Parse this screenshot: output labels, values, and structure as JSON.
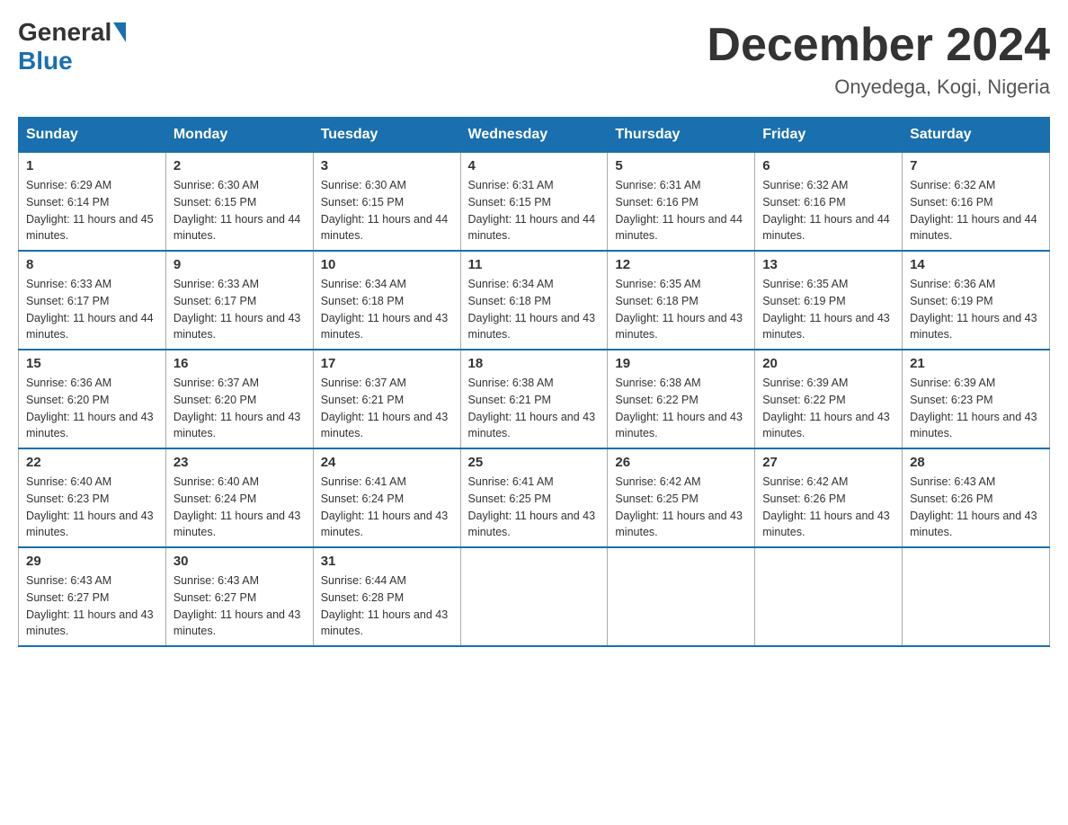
{
  "header": {
    "logo_general": "General",
    "logo_blue": "Blue",
    "month_title": "December 2024",
    "location": "Onyedega, Kogi, Nigeria"
  },
  "weekdays": [
    "Sunday",
    "Monday",
    "Tuesday",
    "Wednesday",
    "Thursday",
    "Friday",
    "Saturday"
  ],
  "weeks": [
    [
      {
        "day": "1",
        "sunrise": "6:29 AM",
        "sunset": "6:14 PM",
        "daylight": "11 hours and 45 minutes."
      },
      {
        "day": "2",
        "sunrise": "6:30 AM",
        "sunset": "6:15 PM",
        "daylight": "11 hours and 44 minutes."
      },
      {
        "day": "3",
        "sunrise": "6:30 AM",
        "sunset": "6:15 PM",
        "daylight": "11 hours and 44 minutes."
      },
      {
        "day": "4",
        "sunrise": "6:31 AM",
        "sunset": "6:15 PM",
        "daylight": "11 hours and 44 minutes."
      },
      {
        "day": "5",
        "sunrise": "6:31 AM",
        "sunset": "6:16 PM",
        "daylight": "11 hours and 44 minutes."
      },
      {
        "day": "6",
        "sunrise": "6:32 AM",
        "sunset": "6:16 PM",
        "daylight": "11 hours and 44 minutes."
      },
      {
        "day": "7",
        "sunrise": "6:32 AM",
        "sunset": "6:16 PM",
        "daylight": "11 hours and 44 minutes."
      }
    ],
    [
      {
        "day": "8",
        "sunrise": "6:33 AM",
        "sunset": "6:17 PM",
        "daylight": "11 hours and 44 minutes."
      },
      {
        "day": "9",
        "sunrise": "6:33 AM",
        "sunset": "6:17 PM",
        "daylight": "11 hours and 43 minutes."
      },
      {
        "day": "10",
        "sunrise": "6:34 AM",
        "sunset": "6:18 PM",
        "daylight": "11 hours and 43 minutes."
      },
      {
        "day": "11",
        "sunrise": "6:34 AM",
        "sunset": "6:18 PM",
        "daylight": "11 hours and 43 minutes."
      },
      {
        "day": "12",
        "sunrise": "6:35 AM",
        "sunset": "6:18 PM",
        "daylight": "11 hours and 43 minutes."
      },
      {
        "day": "13",
        "sunrise": "6:35 AM",
        "sunset": "6:19 PM",
        "daylight": "11 hours and 43 minutes."
      },
      {
        "day": "14",
        "sunrise": "6:36 AM",
        "sunset": "6:19 PM",
        "daylight": "11 hours and 43 minutes."
      }
    ],
    [
      {
        "day": "15",
        "sunrise": "6:36 AM",
        "sunset": "6:20 PM",
        "daylight": "11 hours and 43 minutes."
      },
      {
        "day": "16",
        "sunrise": "6:37 AM",
        "sunset": "6:20 PM",
        "daylight": "11 hours and 43 minutes."
      },
      {
        "day": "17",
        "sunrise": "6:37 AM",
        "sunset": "6:21 PM",
        "daylight": "11 hours and 43 minutes."
      },
      {
        "day": "18",
        "sunrise": "6:38 AM",
        "sunset": "6:21 PM",
        "daylight": "11 hours and 43 minutes."
      },
      {
        "day": "19",
        "sunrise": "6:38 AM",
        "sunset": "6:22 PM",
        "daylight": "11 hours and 43 minutes."
      },
      {
        "day": "20",
        "sunrise": "6:39 AM",
        "sunset": "6:22 PM",
        "daylight": "11 hours and 43 minutes."
      },
      {
        "day": "21",
        "sunrise": "6:39 AM",
        "sunset": "6:23 PM",
        "daylight": "11 hours and 43 minutes."
      }
    ],
    [
      {
        "day": "22",
        "sunrise": "6:40 AM",
        "sunset": "6:23 PM",
        "daylight": "11 hours and 43 minutes."
      },
      {
        "day": "23",
        "sunrise": "6:40 AM",
        "sunset": "6:24 PM",
        "daylight": "11 hours and 43 minutes."
      },
      {
        "day": "24",
        "sunrise": "6:41 AM",
        "sunset": "6:24 PM",
        "daylight": "11 hours and 43 minutes."
      },
      {
        "day": "25",
        "sunrise": "6:41 AM",
        "sunset": "6:25 PM",
        "daylight": "11 hours and 43 minutes."
      },
      {
        "day": "26",
        "sunrise": "6:42 AM",
        "sunset": "6:25 PM",
        "daylight": "11 hours and 43 minutes."
      },
      {
        "day": "27",
        "sunrise": "6:42 AM",
        "sunset": "6:26 PM",
        "daylight": "11 hours and 43 minutes."
      },
      {
        "day": "28",
        "sunrise": "6:43 AM",
        "sunset": "6:26 PM",
        "daylight": "11 hours and 43 minutes."
      }
    ],
    [
      {
        "day": "29",
        "sunrise": "6:43 AM",
        "sunset": "6:27 PM",
        "daylight": "11 hours and 43 minutes."
      },
      {
        "day": "30",
        "sunrise": "6:43 AM",
        "sunset": "6:27 PM",
        "daylight": "11 hours and 43 minutes."
      },
      {
        "day": "31",
        "sunrise": "6:44 AM",
        "sunset": "6:28 PM",
        "daylight": "11 hours and 43 minutes."
      },
      null,
      null,
      null,
      null
    ]
  ]
}
